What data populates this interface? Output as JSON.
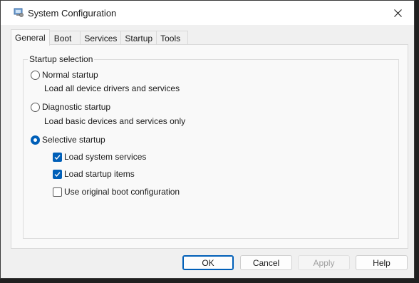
{
  "window": {
    "title": "System Configuration"
  },
  "tabs": [
    {
      "label": "General",
      "active": true
    },
    {
      "label": "Boot",
      "active": false
    },
    {
      "label": "Services",
      "active": false
    },
    {
      "label": "Startup",
      "active": false
    },
    {
      "label": "Tools",
      "active": false
    }
  ],
  "startup_selection": {
    "legend": "Startup selection",
    "normal": {
      "label": "Normal startup",
      "description": "Load all device drivers and services",
      "checked": false
    },
    "diagnostic": {
      "label": "Diagnostic startup",
      "description": "Load basic devices and services only",
      "checked": false
    },
    "selective": {
      "label": "Selective startup",
      "checked": true,
      "options": [
        {
          "label": "Load system services",
          "checked": true
        },
        {
          "label": "Load startup items",
          "checked": true
        },
        {
          "label": "Use original boot configuration",
          "checked": false
        }
      ]
    }
  },
  "buttons": {
    "ok": "OK",
    "cancel": "Cancel",
    "apply": "Apply",
    "help": "Help"
  },
  "colors": {
    "accent": "#005fb8",
    "window_bg": "#f0f0f0",
    "panel_bg": "#f9f9f9"
  },
  "icons": {
    "app": "system-configuration-icon",
    "close": "close-icon",
    "check": "check-icon"
  }
}
